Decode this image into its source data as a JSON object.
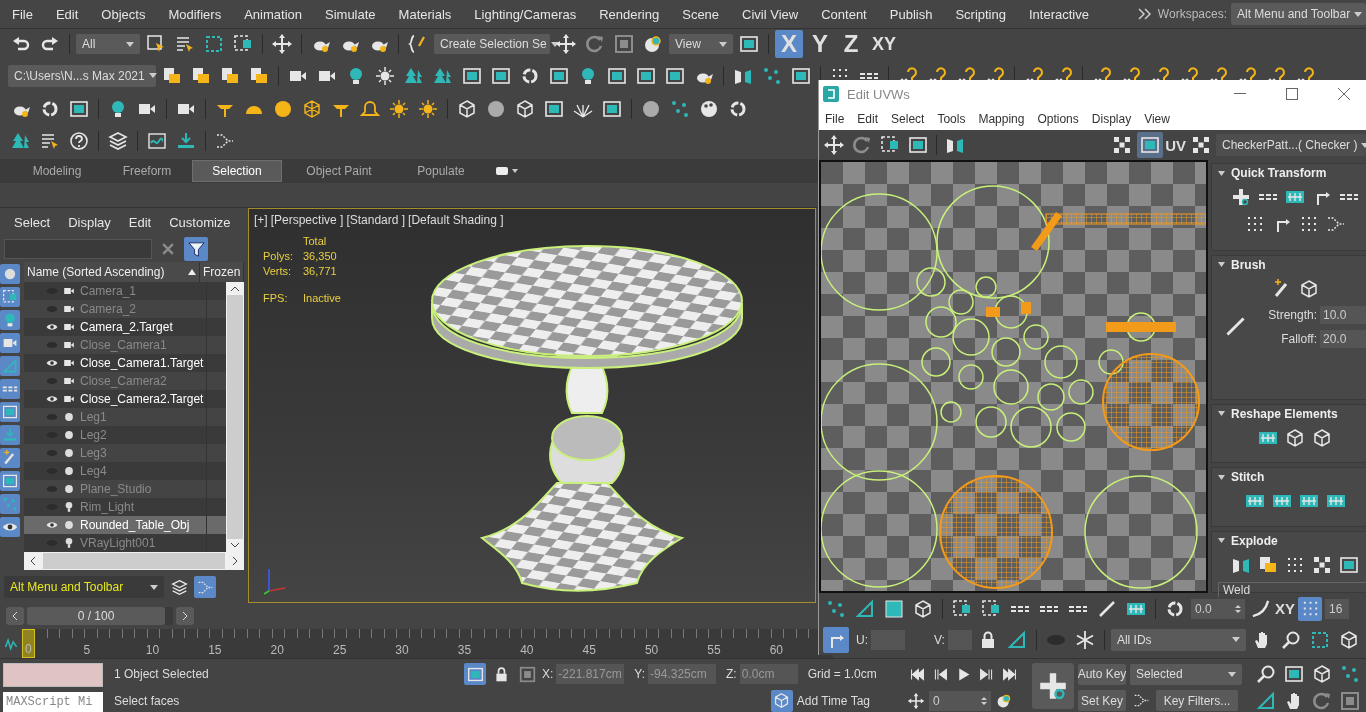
{
  "menu": [
    "File",
    "Edit",
    "Objects",
    "Modifiers",
    "Animation",
    "Simulate",
    "Materials",
    "Lighting/Cameras",
    "Rendering",
    "Scene",
    "Civil View",
    "Content",
    "Publish",
    "Scripting",
    "Interactive"
  ],
  "workspaces": {
    "label": "Workspaces:",
    "value": "Alt Menu and Toolbar"
  },
  "toolbar": {
    "filter": "All",
    "selection_set": "Create Selection Se",
    "ref_coord": "View",
    "project_path": "C:\\Users\\N...s Max 2021",
    "axes": [
      {
        "label": "X",
        "selected": true
      },
      {
        "label": "Y",
        "selected": false
      },
      {
        "label": "Z",
        "selected": false
      },
      {
        "label": "XY",
        "selected": false
      }
    ]
  },
  "ribbon_tabs": [
    {
      "label": "Modeling",
      "selected": false
    },
    {
      "label": "Freeform",
      "selected": false
    },
    {
      "label": "Selection",
      "selected": true
    },
    {
      "label": "Object Paint",
      "selected": false
    },
    {
      "label": "Populate",
      "selected": false
    }
  ],
  "explorer": {
    "menu": [
      "Select",
      "Display",
      "Edit",
      "Customize"
    ],
    "columns": [
      "Name (Sorted Ascending)",
      "Frozen"
    ],
    "rows": [
      {
        "name": "Camera_1",
        "kind": "camera",
        "visible": false,
        "selected": false
      },
      {
        "name": "Camera_2",
        "kind": "camera",
        "visible": false,
        "selected": false
      },
      {
        "name": "Camera_2.Target",
        "kind": "camera",
        "visible": true,
        "selected": false
      },
      {
        "name": "Close_Camera1",
        "kind": "camera",
        "visible": false,
        "selected": false
      },
      {
        "name": "Close_Camera1.Target",
        "kind": "camera",
        "visible": true,
        "selected": false
      },
      {
        "name": "Close_Camera2",
        "kind": "camera",
        "visible": false,
        "selected": false
      },
      {
        "name": "Close_Camera2.Target",
        "kind": "camera",
        "visible": true,
        "selected": false
      },
      {
        "name": "Leg1",
        "kind": "object",
        "visible": false,
        "selected": false
      },
      {
        "name": "Leg2",
        "kind": "object",
        "visible": false,
        "selected": false
      },
      {
        "name": "Leg3",
        "kind": "object",
        "visible": false,
        "selected": false
      },
      {
        "name": "Leg4",
        "kind": "object",
        "visible": false,
        "selected": false
      },
      {
        "name": "Plane_Studio",
        "kind": "object",
        "visible": false,
        "selected": false
      },
      {
        "name": "Rim_Light",
        "kind": "light",
        "visible": false,
        "selected": false
      },
      {
        "name": "Rounded_Table_Obj",
        "kind": "object",
        "visible": true,
        "selected": true
      },
      {
        "name": "VRayLight001",
        "kind": "light",
        "visible": false,
        "selected": false
      }
    ],
    "layer": "Alt Menu and Toolbar"
  },
  "viewport": {
    "labels": [
      "[+]",
      "[Perspective ]",
      "[Standard ]",
      "[Default Shading ]"
    ],
    "stats_header": "Total",
    "stats": [
      {
        "label": "Polys:",
        "value": "36,350"
      },
      {
        "label": "Verts:",
        "value": "36,771"
      }
    ],
    "fps_label": "FPS:",
    "fps_value": "Inactive"
  },
  "uvw_editor": {
    "title": "Edit UVWs",
    "menu": [
      "File",
      "Edit",
      "Select",
      "Tools",
      "Mapping",
      "Options",
      "Display",
      "View"
    ],
    "uv_label": "UV",
    "texture": "CheckerPatt...( Checker )",
    "rollouts": [
      {
        "title": "Quick Transform",
        "kind": "quick"
      },
      {
        "title": "Brush",
        "kind": "brush",
        "fields": [
          {
            "label": "Strength:",
            "value": "10.0"
          },
          {
            "label": "Falloff:",
            "value": "20.0"
          }
        ]
      },
      {
        "title": "Reshape Elements",
        "kind": "reshape"
      },
      {
        "title": "Stitch",
        "kind": "stitch"
      },
      {
        "title": "Explode",
        "kind": "explode",
        "group": "Weld"
      }
    ],
    "bottom": {
      "angle": "0.0",
      "axis": "XY",
      "count": "16",
      "u_label": "U:",
      "v_label": "V:",
      "ids": "All IDs"
    }
  },
  "timeline": {
    "position": "0 / 100",
    "level": 0,
    "ticks": [
      {
        "label": "0",
        "selected": true
      },
      {
        "label": "5",
        "selected": false
      },
      {
        "label": "10",
        "selected": false
      },
      {
        "label": "15",
        "selected": false
      },
      {
        "label": "20",
        "selected": false
      },
      {
        "label": "25",
        "selected": false
      },
      {
        "label": "30",
        "selected": false
      },
      {
        "label": "35",
        "selected": false
      },
      {
        "label": "40",
        "selected": false
      },
      {
        "label": "45",
        "selected": false
      },
      {
        "label": "50",
        "selected": false
      },
      {
        "label": "55",
        "selected": false
      },
      {
        "label": "60",
        "selected": false
      }
    ]
  },
  "status": {
    "script": "MAXScript Mi",
    "messages": [
      "1 Object Selected",
      "Select faces"
    ],
    "coords": [
      {
        "label": "X:",
        "value": "-221.817cm"
      },
      {
        "label": "Y:",
        "value": "-94.325cm"
      },
      {
        "label": "Z:",
        "value": "0.0cm"
      }
    ],
    "grid": "Grid = 1.0cm",
    "time_tag": "Add Time Tag",
    "frame": "0",
    "auto_key": "Auto Key",
    "key_mode": "Selected",
    "set_key": "Set Key",
    "key_filters": "Key Filters..."
  }
}
